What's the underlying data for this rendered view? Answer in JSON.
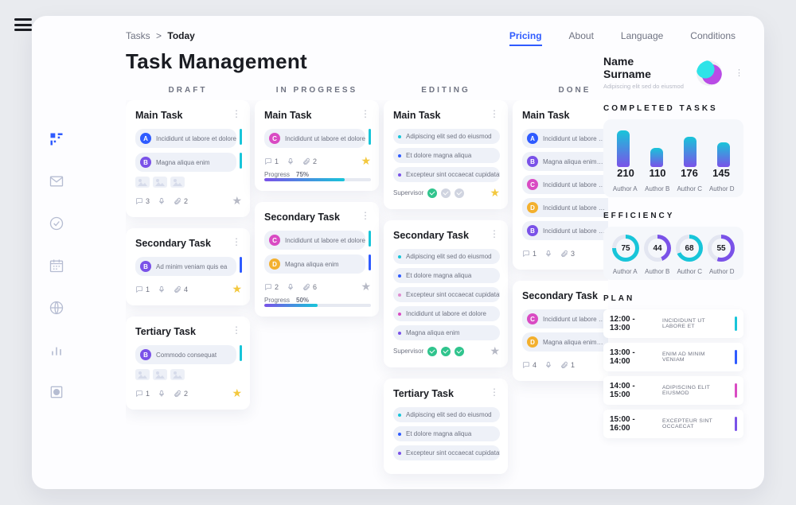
{
  "breadcrumb": {
    "root": "Tasks",
    "sep": ">",
    "current": "Today"
  },
  "page_title": "Task Management",
  "nav_tabs": [
    {
      "label": "Pricing",
      "active": true
    },
    {
      "label": "About",
      "active": false
    },
    {
      "label": "Language",
      "active": false
    },
    {
      "label": "Conditions",
      "active": false
    }
  ],
  "columns": [
    {
      "header": "DRAFT"
    },
    {
      "header": "IN PROGRESS"
    },
    {
      "header": "EDITING"
    },
    {
      "header": "DONE"
    }
  ],
  "board": {
    "draft": [
      {
        "title": "Main Task",
        "items": [
          {
            "letter": "A",
            "color": "#2f5bff",
            "text": "Incididunt ut labore et dolore",
            "stripe": "#18c5d9"
          },
          {
            "letter": "B",
            "color": "#7a52e8",
            "text": "Magna aliqua enim",
            "stripe": "#18c5d9"
          }
        ],
        "thumbs": 3,
        "comments": 3,
        "attachments": 2,
        "starred": false
      },
      {
        "title": "Secondary Task",
        "items": [
          {
            "letter": "B",
            "color": "#7a52e8",
            "text": "Ad minim veniam  quis ea",
            "stripe": "#2f5bff"
          }
        ],
        "comments": 1,
        "attachments": 4,
        "starred": true
      },
      {
        "title": "Tertiary Task",
        "items": [
          {
            "letter": "B",
            "color": "#7a52e8",
            "text": "Commodo consequat",
            "stripe": "#18c5d9"
          }
        ],
        "thumbs": 3,
        "comments": 1,
        "attachments": 2,
        "starred": true
      }
    ],
    "in_progress": [
      {
        "title": "Main Task",
        "items": [
          {
            "letter": "C",
            "color": "#d94bc3",
            "text": "Incididunt ut labore et dolore",
            "stripe": "#18c5d9"
          }
        ],
        "comments": 1,
        "attachments": 2,
        "starred": true,
        "progress_label": "Progress",
        "progress_pct": 75
      },
      {
        "title": "Secondary Task",
        "items": [
          {
            "letter": "C",
            "color": "#d94bc3",
            "text": "Incididunt ut labore et dolore",
            "stripe": "#18c5d9"
          },
          {
            "letter": "D",
            "color": "#f3b02e",
            "text": "Magna aliqua enim",
            "stripe": "#2f5bff"
          }
        ],
        "comments": 2,
        "attachments": 6,
        "starred": false,
        "progress_label": "Progress",
        "progress_pct": 50
      }
    ],
    "editing": [
      {
        "title": "Main Task",
        "lines": [
          {
            "dot": "#18c5d9",
            "text": "Adipiscing elit sed do eiusmod"
          },
          {
            "dot": "#2f5bff",
            "text": "Et dolore magna aliqua"
          },
          {
            "dot": "#7a52e8",
            "text": "Excepteur sint occaecat cupidatat"
          }
        ],
        "supervisor_label": "Supervisor",
        "checks": [
          "on",
          "off",
          "off"
        ],
        "starred": true
      },
      {
        "title": "Secondary Task",
        "lines": [
          {
            "dot": "#18c5d9",
            "text": "Adipiscing elit sed do eiusmod"
          },
          {
            "dot": "#2f5bff",
            "text": "Et dolore magna aliqua"
          },
          {
            "dot": "#e08ccf",
            "text": "Excepteur sint occaecat cupidatat"
          },
          {
            "dot": "#d94bc3",
            "text": "Incididunt ut labore et dolore"
          },
          {
            "dot": "#7a52e8",
            "text": "Magna aliqua enim"
          }
        ],
        "supervisor_label": "Supervisor",
        "checks": [
          "on",
          "on",
          "on"
        ],
        "starred": false
      },
      {
        "title": "Tertiary Task",
        "lines": [
          {
            "dot": "#18c5d9",
            "text": "Adipiscing elit sed do eiusmod"
          },
          {
            "dot": "#2f5bff",
            "text": "Et dolore magna aliqua"
          },
          {
            "dot": "#7a52e8",
            "text": "Excepteur sint occaecat cupidatat"
          }
        ]
      }
    ],
    "done": [
      {
        "title": "Main Task",
        "items": [
          {
            "letter": "A",
            "color": "#2f5bff",
            "text": "Incididunt ut labore et n…",
            "check": true
          },
          {
            "letter": "B",
            "color": "#7a52e8",
            "text": "Magna aliqua enim…",
            "check": true
          },
          {
            "letter": "C",
            "color": "#d94bc3",
            "text": "Incididunt ut labore et n…",
            "check": true
          },
          {
            "letter": "D",
            "color": "#f3b02e",
            "text": "Incididunt ut labore et n…",
            "check": true
          },
          {
            "letter": "B",
            "color": "#7a52e8",
            "text": "Incididunt ut labore et n…",
            "check": true
          }
        ],
        "comments": 1,
        "attachments": 3,
        "starred": false
      },
      {
        "title": "Secondary Task",
        "items": [
          {
            "letter": "C",
            "color": "#d94bc3",
            "text": "Incididunt ut labore et n…",
            "check": true
          },
          {
            "letter": "D",
            "color": "#f3b02e",
            "text": "Magna aliqua enim…",
            "check": true
          }
        ],
        "comments": 4,
        "attachments": 1,
        "starred": true
      }
    ]
  },
  "profile": {
    "name_line1": "Name",
    "name_line2": "Surname",
    "sub": "Adipiscing elit sed do eiusmod"
  },
  "completed": {
    "title": "COMPLETED TASKS",
    "values": [
      210,
      110,
      176,
      145
    ],
    "labels": [
      "Author A",
      "Author B",
      "Author C",
      "Author D"
    ]
  },
  "efficiency": {
    "title": "EFFICIENCY",
    "values": [
      75,
      44,
      68,
      55
    ],
    "colors": [
      "#18c5d9",
      "#7a52e8",
      "#18c5d9",
      "#7a52e8"
    ],
    "labels": [
      "Author A",
      "Author B",
      "Author C",
      "Author D"
    ]
  },
  "plan": {
    "title": "PLAN",
    "items": [
      {
        "time": "12:00 - 13:00",
        "text": "Incididunt ut labore et",
        "color": "#18c5d9"
      },
      {
        "time": "13:00 - 14:00",
        "text": "Enim ad minim veniam",
        "color": "#2f5bff"
      },
      {
        "time": "14:00 - 15:00",
        "text": "Adipiscing elit eiusmod",
        "color": "#d94bc3"
      },
      {
        "time": "15:00 - 16:00",
        "text": "Excepteur sint occaecat",
        "color": "#7a52e8"
      }
    ]
  },
  "chart_data": [
    {
      "type": "bar",
      "title": "COMPLETED TASKS",
      "categories": [
        "Author A",
        "Author B",
        "Author C",
        "Author D"
      ],
      "values": [
        210,
        110,
        176,
        145
      ],
      "ylim": [
        0,
        210
      ]
    },
    {
      "type": "radial",
      "title": "EFFICIENCY",
      "categories": [
        "Author A",
        "Author B",
        "Author C",
        "Author D"
      ],
      "values": [
        75,
        44,
        68,
        55
      ],
      "unit": "percent"
    }
  ]
}
